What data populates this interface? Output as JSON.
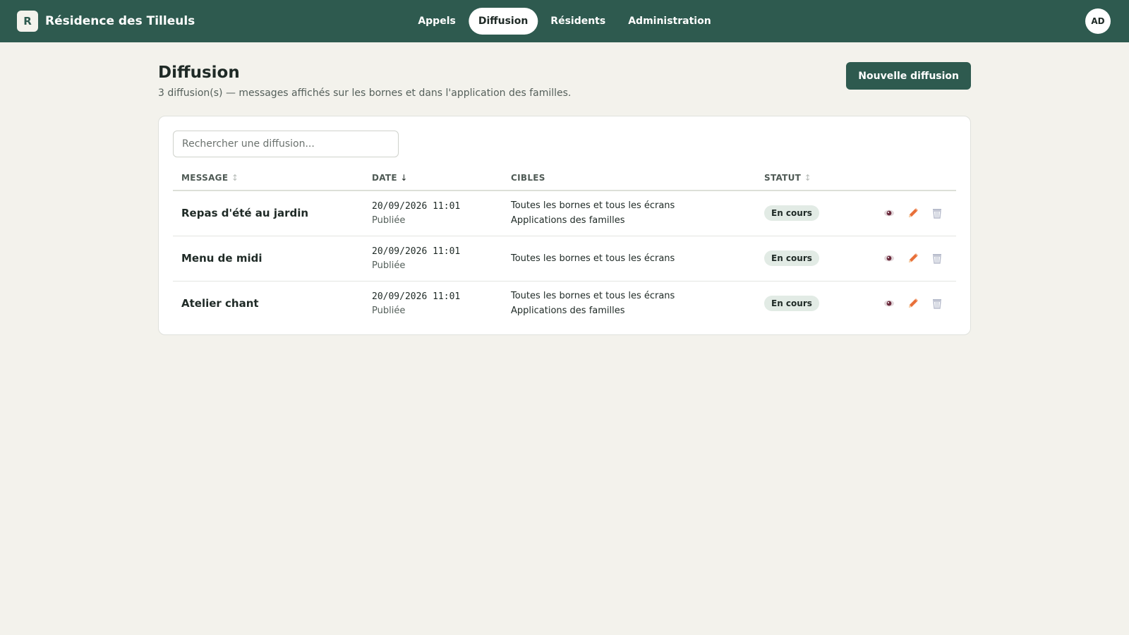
{
  "header": {
    "brand_initial": "R",
    "brand_name": "Résidence des Tilleuls",
    "nav": [
      {
        "label": "Appels",
        "active": false
      },
      {
        "label": "Diffusion",
        "active": true
      },
      {
        "label": "Résidents",
        "active": false
      },
      {
        "label": "Administration",
        "active": false
      }
    ],
    "user_initials": "AD"
  },
  "page": {
    "title": "Diffusion",
    "subtitle": "3 diffusion(s) — messages affichés sur les bornes et dans l'application des familles.",
    "new_button": "Nouvelle diffusion"
  },
  "search": {
    "placeholder": "Rechercher une diffusion..."
  },
  "table": {
    "columns": {
      "message": "MESSAGE",
      "date": "DATE",
      "targets": "CIBLES",
      "status": "STATUT"
    },
    "sort_icons": {
      "message": "↕",
      "date": "↓",
      "status": "↕"
    },
    "rows": [
      {
        "message": "Repas d'été au jardin",
        "date": "20/09/2026 11:01",
        "date_state": "Publiée",
        "target_1": "Toutes les bornes et tous les écrans",
        "target_2": "Applications des familles",
        "status": "En cours"
      },
      {
        "message": "Menu de midi",
        "date": "20/09/2026 11:01",
        "date_state": "Publiée",
        "target_1": "Toutes les bornes et tous les écrans",
        "target_2": "",
        "status": "En cours"
      },
      {
        "message": "Atelier chant",
        "date": "20/09/2026 11:01",
        "date_state": "Publiée",
        "target_1": "Toutes les bornes et tous les écrans",
        "target_2": "Applications des familles",
        "status": "En cours"
      }
    ],
    "row_actions": [
      "eye-icon",
      "pencil-icon",
      "trash-icon"
    ]
  },
  "colors": {
    "header_bg": "#2e5a4f",
    "page_bg": "#f3f2ec",
    "badge_bg": "#e2ebe5",
    "edit_icon": "#e8703a"
  }
}
